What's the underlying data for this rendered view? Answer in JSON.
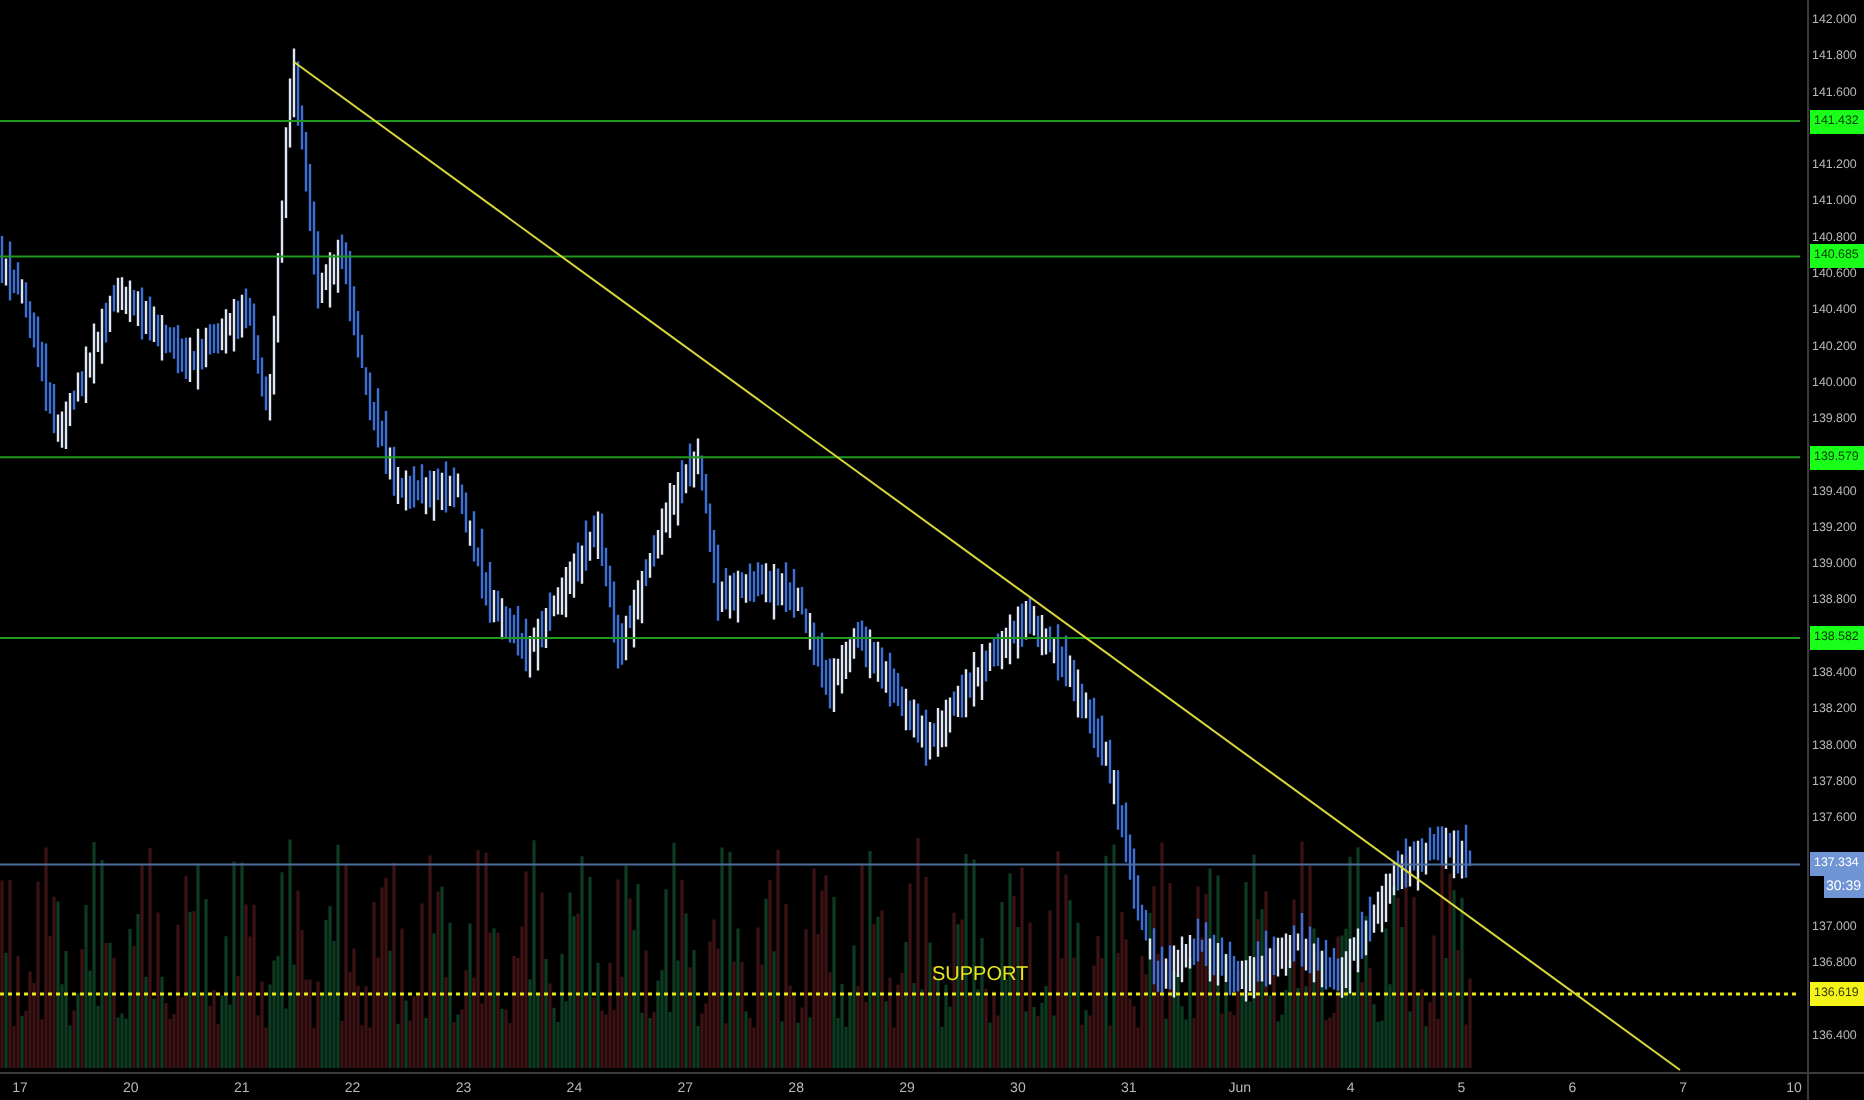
{
  "price_axis": {
    "ticks": [
      "142.000",
      "141.800",
      "141.600",
      "141.200",
      "141.000",
      "140.800",
      "140.600",
      "140.400",
      "140.200",
      "140.000",
      "139.800",
      "139.400",
      "139.200",
      "139.000",
      "138.800",
      "138.400",
      "138.200",
      "138.000",
      "137.800",
      "137.600",
      "137.000",
      "136.800",
      "136.400"
    ]
  },
  "time_axis": {
    "labels": [
      "17",
      "20",
      "21",
      "22",
      "23",
      "24",
      "27",
      "28",
      "29",
      "30",
      "31",
      "Jun",
      "4",
      "5",
      "6",
      "7",
      "10"
    ]
  },
  "levels": [
    {
      "price": "141.432",
      "kind": "resistance"
    },
    {
      "price": "140.685",
      "kind": "resistance"
    },
    {
      "price": "139.579",
      "kind": "resistance"
    },
    {
      "price": "138.582",
      "kind": "resistance"
    },
    {
      "price": "136.619",
      "kind": "support",
      "caption": "SUPPORT"
    }
  ],
  "last_price": {
    "price": "137.334",
    "countdown": "30:39"
  }
}
